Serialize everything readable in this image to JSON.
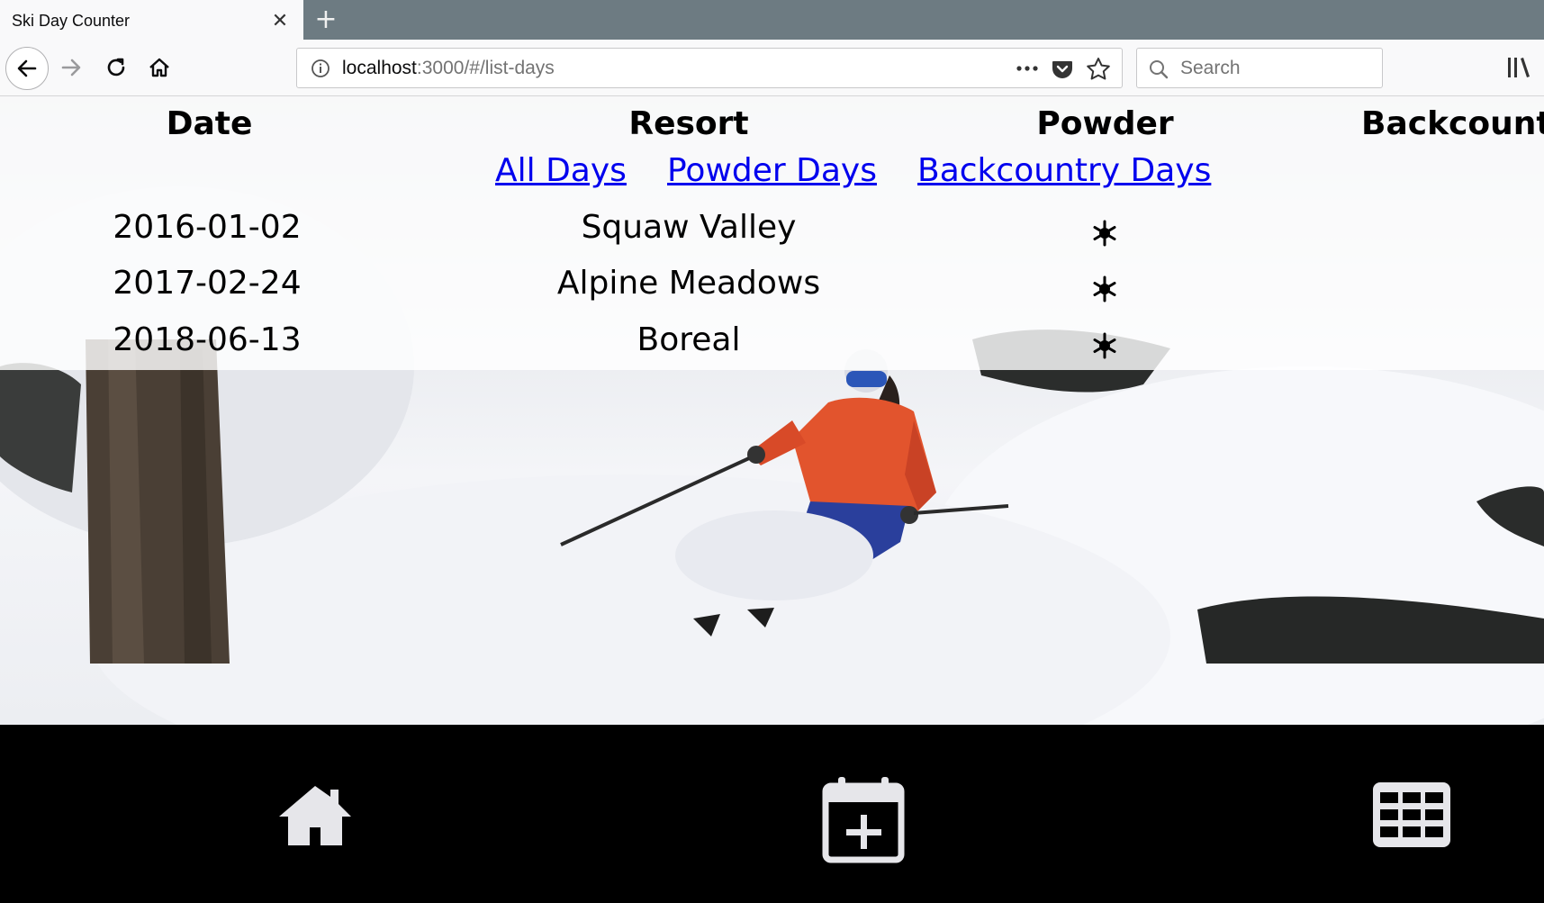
{
  "browser": {
    "tab_title": "Ski Day Counter",
    "url_host": "localhost",
    "url_path": ":3000/#/list-days",
    "search_placeholder": "Search"
  },
  "table": {
    "headers": [
      "Date",
      "Resort",
      "Powder",
      "Backcount"
    ],
    "filter_links": [
      "All Days",
      "Powder Days",
      "Backcountry Days"
    ],
    "rows": [
      {
        "date": "2016-01-02",
        "resort": "Squaw Valley",
        "powder": true
      },
      {
        "date": "2017-02-24",
        "resort": "Alpine Meadows",
        "powder": true
      },
      {
        "date": "2018-06-13",
        "resort": "Boreal",
        "powder": true
      }
    ]
  },
  "footer": {
    "icons": [
      "home-icon",
      "calendar-plus-icon",
      "grid-icon"
    ]
  },
  "colors": {
    "link": "#0000ee",
    "tabbar": "#6d7b82",
    "footer": "#000000"
  }
}
